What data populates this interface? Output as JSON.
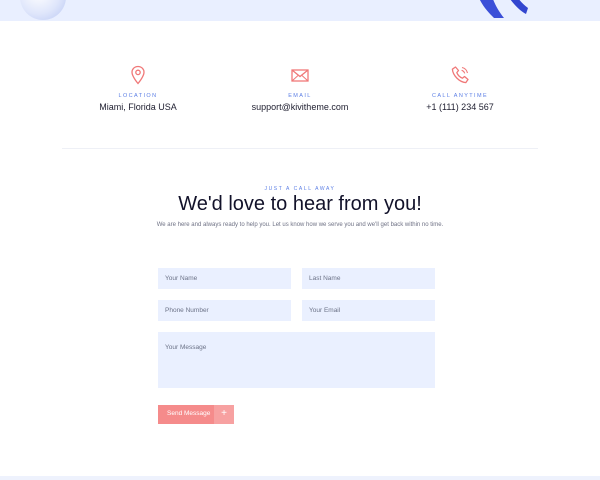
{
  "info": [
    {
      "icon": "location-pin-icon",
      "label": "LOCATION",
      "value": "Miami, Florida USA"
    },
    {
      "icon": "envelope-icon",
      "label": "EMAIL",
      "value": "support@kivitheme.com"
    },
    {
      "icon": "phone-icon",
      "label": "CALL ANYTIME",
      "value": "+1 (111) 234 567"
    }
  ],
  "contact": {
    "eyebrow": "JUST A CALL AWAY",
    "heading_bold": "We'd love to",
    "heading_light": " hear from you!",
    "subtext": "We are here and always ready to help you. Let us know how we serve you and we'll get back within no time."
  },
  "form": {
    "first_name_placeholder": "Your Name",
    "last_name_placeholder": "Last Name",
    "phone_placeholder": "Phone Number",
    "email_placeholder": "Your Email",
    "message_placeholder": "Your Message",
    "submit_label": "Send Message",
    "submit_icon": "+"
  },
  "colors": {
    "accent_coral": "#f58b8b",
    "accent_blue": "#5b7ee5",
    "field_bg": "#eaf0ff"
  }
}
